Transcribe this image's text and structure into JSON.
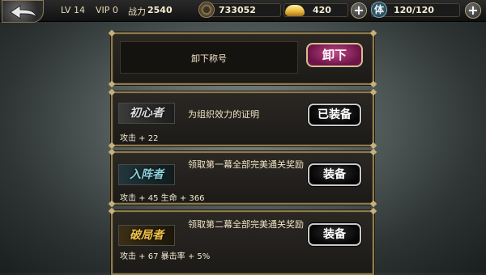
{
  "topbar": {
    "level": "LV 14",
    "vip": "VIP 0",
    "power_label": "战力",
    "power_value": "2540",
    "coins": "733052",
    "ingots": "420",
    "stamina_glyph": "体",
    "stamina": "120/120"
  },
  "icons": {
    "back": "back-arrow-icon",
    "coin": "coin-icon",
    "ingot": "gold-ingot-icon",
    "stamina": "stamina-icon",
    "plus": "plus-icon"
  },
  "unequip_panel": {
    "label": "卸下称号",
    "button": "卸下"
  },
  "titles": [
    {
      "badge": "初心者",
      "desc": "为组织效力的证明",
      "stats": "攻击 + 22",
      "button": "已装备",
      "badge_style": "gray"
    },
    {
      "badge": "入阵者",
      "desc": "领取第一幕全部完美通关奖励",
      "stats": "攻击 + 45 生命 + 366",
      "button": "装备",
      "badge_style": "teal"
    },
    {
      "badge": "破局者",
      "desc": "领取第二幕全部完美通关奖励",
      "stats": "攻击 + 67 暴击率 + 5%",
      "button": "装备",
      "badge_style": "gold"
    }
  ],
  "colors": {
    "frame_gold": "#8d7b4d",
    "unequip_button": "#a02c6b",
    "panel_bg": "#14130f"
  }
}
